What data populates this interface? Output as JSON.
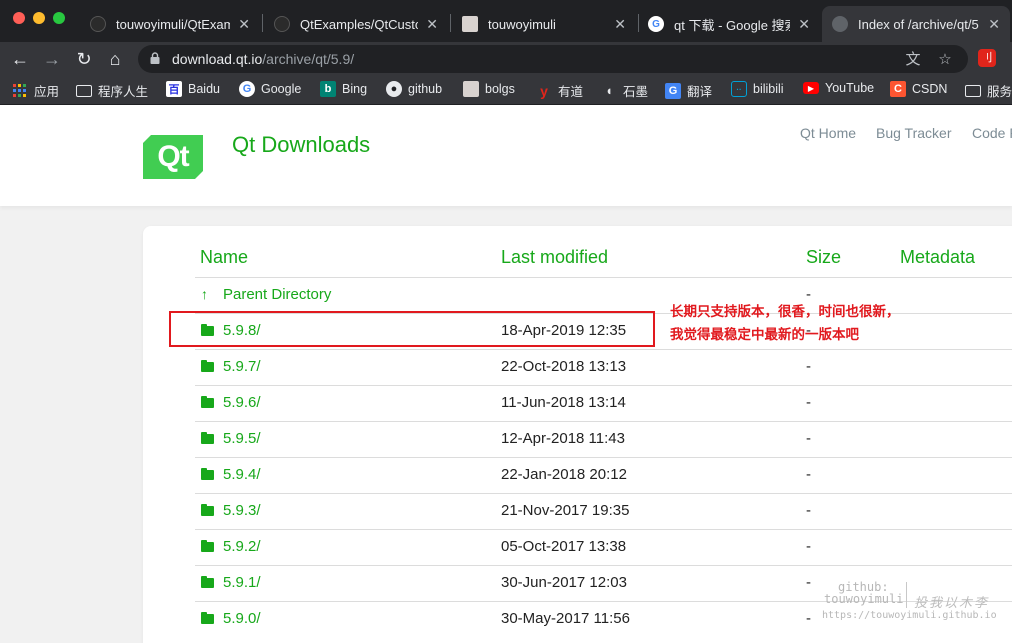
{
  "window": {
    "traffic_colors": [
      "#ff5f57",
      "#febc2e",
      "#28c840"
    ]
  },
  "tabs": [
    {
      "title": "touwoyimuli/QtExamp",
      "icon": "github-icon",
      "close": "✕",
      "active": false
    },
    {
      "title": "QtExamples/QtCustor",
      "icon": "github-icon",
      "close": "✕",
      "active": false
    },
    {
      "title": "touwoyimuli",
      "icon": "avatar-icon",
      "close": "✕",
      "active": false
    },
    {
      "title": "qt 下载 - Google 搜索",
      "icon": "google-icon",
      "close": "✕",
      "active": false
    },
    {
      "title": "Index of /archive/qt/5",
      "icon": "globe-icon",
      "close": "✕",
      "active": true
    }
  ],
  "toolbar": {
    "back_icon": "←",
    "forward_icon": "→",
    "reload_icon": "↻",
    "home_icon": "⌂",
    "url_host": "download.qt.io",
    "url_path": "/archive/qt/5.9/",
    "translate_icon": "文",
    "star_icon": "☆",
    "extension_icon": "刂"
  },
  "bookmarks": [
    {
      "label": "应用",
      "icon": "apps-grid-icon"
    },
    {
      "label": "程序人生",
      "icon": "folder-icon"
    },
    {
      "label": "Baidu",
      "icon": "baidu-icon"
    },
    {
      "label": "Google",
      "icon": "google-icon"
    },
    {
      "label": "Bing",
      "icon": "bing-icon"
    },
    {
      "label": "github",
      "icon": "github-icon"
    },
    {
      "label": "bolgs",
      "icon": "avatar-icon"
    },
    {
      "label": "有道",
      "icon": "youdao-icon"
    },
    {
      "label": "石墨",
      "icon": "shimo-icon"
    },
    {
      "label": "翻译",
      "icon": "google-translate-icon"
    },
    {
      "label": "bilibili",
      "icon": "bilibili-icon"
    },
    {
      "label": "YouTube",
      "icon": "youtube-icon"
    },
    {
      "label": "CSDN",
      "icon": "csdn-icon"
    },
    {
      "label": "服务",
      "icon": "folder-icon"
    }
  ],
  "header": {
    "logo_text": "Qt",
    "title": "Qt Downloads",
    "nav": [
      "Qt Home",
      "Bug Tracker",
      "Code Re"
    ]
  },
  "listing": {
    "columns": {
      "name": "Name",
      "modified": "Last modified",
      "size": "Size",
      "metadata": "Metadata"
    },
    "parent": {
      "name": "Parent Directory",
      "size": "-"
    },
    "rows": [
      {
        "name": "5.9.8/",
        "modified": "18-Apr-2019 12:35",
        "size": "-"
      },
      {
        "name": "5.9.7/",
        "modified": "22-Oct-2018 13:13",
        "size": "-"
      },
      {
        "name": "5.9.6/",
        "modified": "11-Jun-2018 13:14",
        "size": "-"
      },
      {
        "name": "5.9.5/",
        "modified": "12-Apr-2018 11:43",
        "size": "-"
      },
      {
        "name": "5.9.4/",
        "modified": "22-Jan-2018 20:12",
        "size": "-"
      },
      {
        "name": "5.9.3/",
        "modified": "21-Nov-2017 19:35",
        "size": "-"
      },
      {
        "name": "5.9.2/",
        "modified": "05-Oct-2017 13:38",
        "size": "-"
      },
      {
        "name": "5.9.1/",
        "modified": "30-Jun-2017 12:03",
        "size": "-"
      },
      {
        "name": "5.9.0/",
        "modified": "30-May-2017 11:56",
        "size": "-"
      }
    ]
  },
  "annotation": {
    "line1": "长期只支持版本，很香，时间也很新，",
    "line2": "我觉得最稳定中最新的一版本吧",
    "color": "#e1191e"
  },
  "watermark": {
    "line1": "github:",
    "line2": "touwoyimuli",
    "line3": "https://touwoyimuli.github.io",
    "signature": "投我以木李"
  },
  "colors": {
    "qt_green": "#41cd52",
    "link_green": "#17a81a"
  }
}
